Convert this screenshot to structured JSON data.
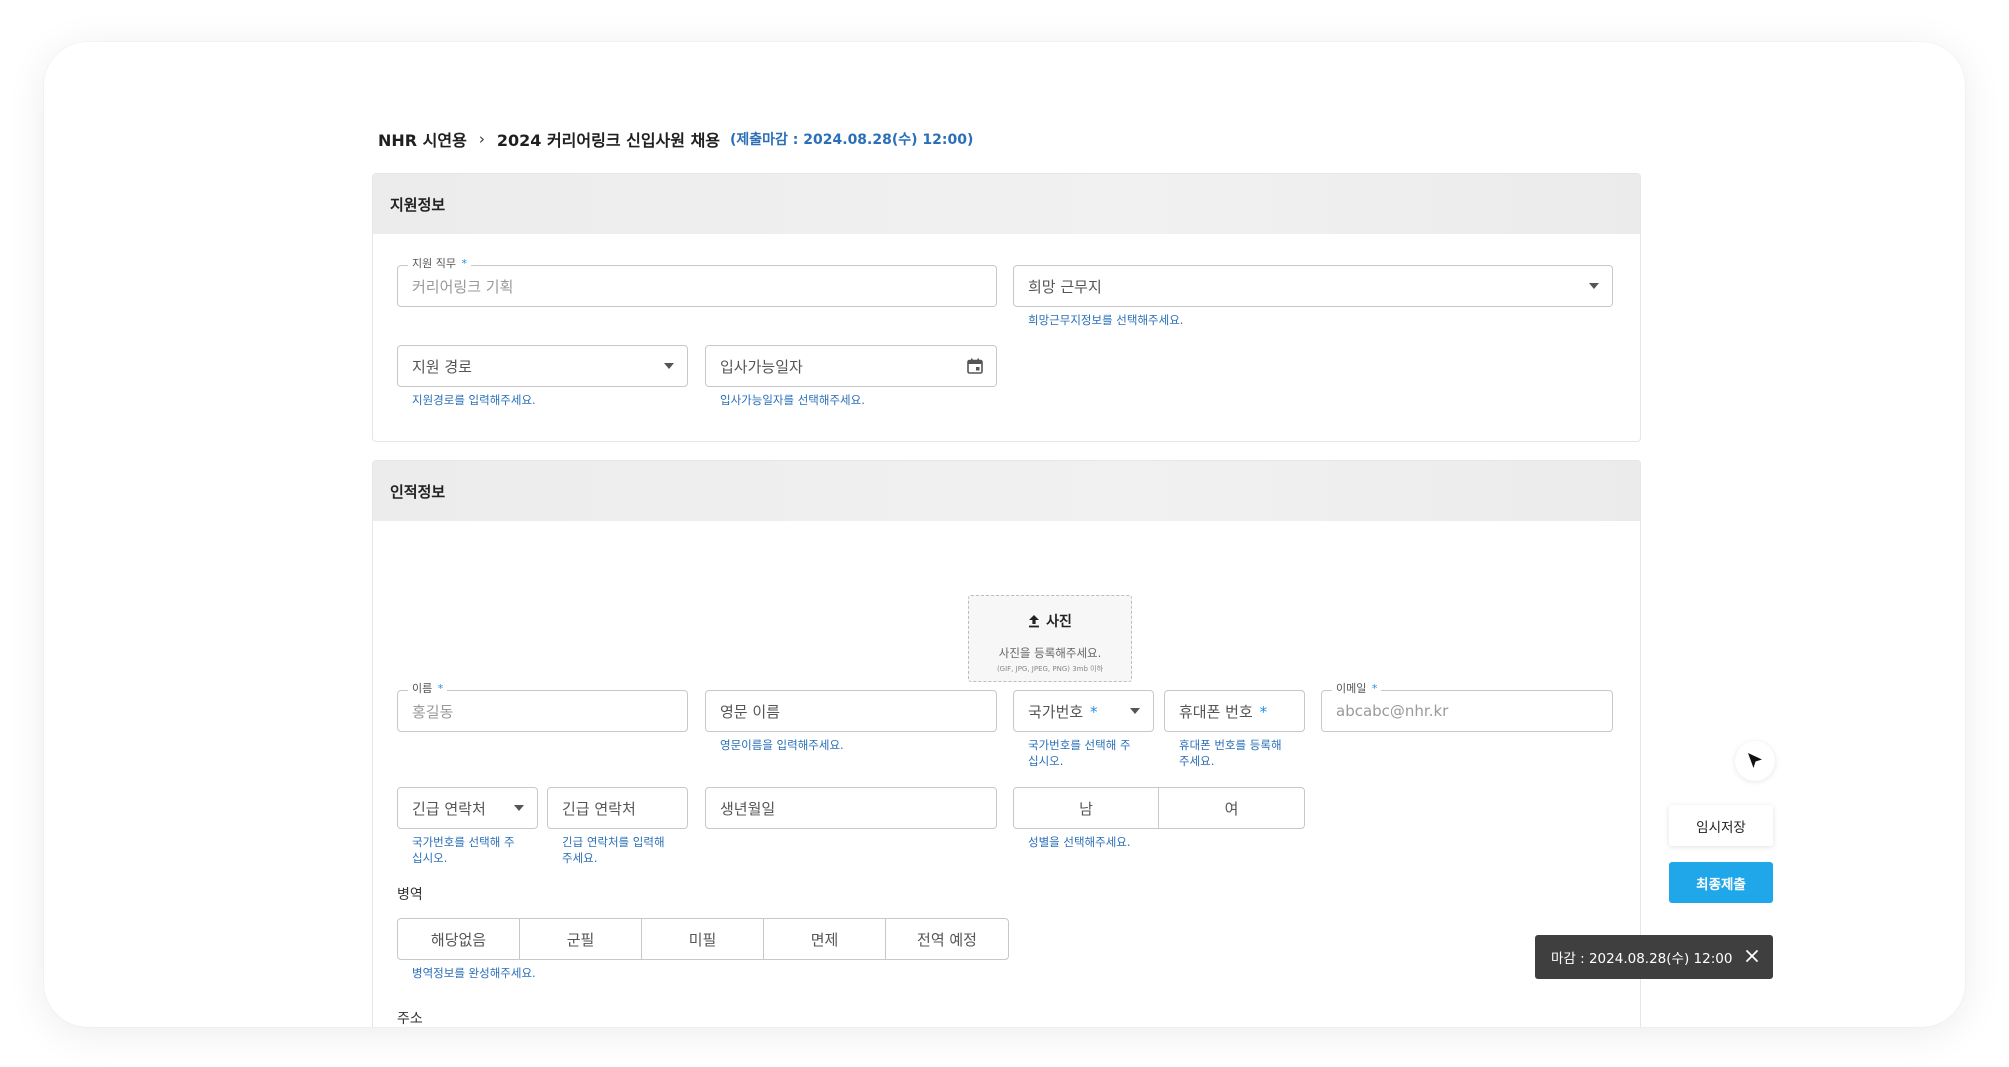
{
  "breadcrumb": {
    "company": "NHR 시연용",
    "separator": "›",
    "posting": "2024 커리어링크 신입사원 채용",
    "deadline": "(제출마감 : 2024.08.28(수) 12:00)"
  },
  "apply_info": {
    "title": "지원정보",
    "job": {
      "label": "지원 직무",
      "required": "*",
      "value": "커리어링크 기획"
    },
    "location": {
      "placeholder": "희망 근무지",
      "helper": "희망근무지정보를 선택해주세요."
    },
    "route": {
      "placeholder": "지원 경로",
      "helper": "지원경로를 입력해주세요."
    },
    "start_date": {
      "placeholder": "입사가능일자",
      "helper": "입사가능일자를 선택해주세요."
    }
  },
  "personal_info": {
    "title": "인적정보",
    "photo": {
      "title": "사진",
      "desc": "사진을 등록해주세요.",
      "formats": "(GIF, JPG, JPEG, PNG) 3mb 이하"
    },
    "name": {
      "label": "이름",
      "required": "*",
      "value": "홍길동"
    },
    "english_name": {
      "placeholder": "영문 이름",
      "helper": "영문이름을 입력해주세요."
    },
    "country_code": {
      "placeholder": "국가번호",
      "required": "*",
      "helper_1": "국가번호를 선택해 주",
      "helper_2": "십시오."
    },
    "mobile": {
      "placeholder": "휴대폰 번호",
      "required": "*",
      "helper_1": "휴대폰 번호를 등록해",
      "helper_2": "주세요."
    },
    "email": {
      "label": "이메일",
      "required": "*",
      "value": "abcabc@nhr.kr"
    },
    "emergency_code": {
      "placeholder": "긴급 연락처",
      "helper_1": "국가번호를 선택해 주",
      "helper_2": "십시오."
    },
    "emergency_phone": {
      "placeholder": "긴급 연락처",
      "helper_1": "긴급 연락처를 입력해",
      "helper_2": "주세요."
    },
    "birth": {
      "placeholder": "생년월일"
    },
    "gender": {
      "options": [
        "남",
        "여"
      ],
      "helper": "성별을 선택해주세요."
    },
    "military": {
      "label": "병역",
      "options": [
        "해당없음",
        "군필",
        "미필",
        "면제",
        "전역 예정"
      ],
      "helper": "병역정보를 완성해주세요."
    },
    "address": {
      "label": "주소"
    }
  },
  "actions": {
    "temp_save": "임시저장",
    "final_submit": "최종제출"
  },
  "toast": {
    "text": "마감 : 2024.08.28(수) 12:00"
  },
  "colors": {
    "accent": "#1fa7ea",
    "helper_text": "#2a6fb8",
    "required": "#1e90e6",
    "toast_bg": "#3f3f3f"
  }
}
